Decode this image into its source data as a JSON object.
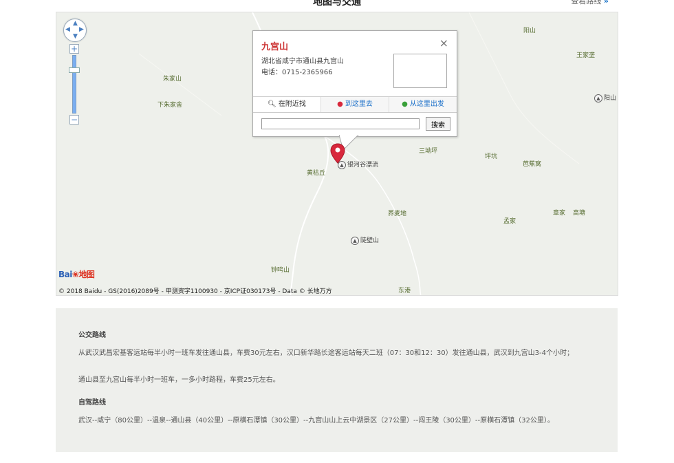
{
  "page": {
    "title": "地图与交通",
    "view_route": "查看路线",
    "view_route_arrow": "»"
  },
  "map": {
    "places": {
      "yangshan": "阳山",
      "wangjiawan": "王家垄",
      "zhujiashan": "朱家山",
      "xiazhujiashe": "下朱家舍",
      "yangshan_peak": "阳山",
      "sandiping": "三坳坪",
      "pingkeng": "坪坑",
      "bajiaowo": "芭蕉窝",
      "huangguqiu": "黄枯丘",
      "yinhegu": "银河谷漂流",
      "qiaomaidi": "荞麦地",
      "mengjia": "孟家",
      "zhangjia": "章家",
      "gaotang": "高塘",
      "doubishan": "陡壁山",
      "zhongmingshan": "钟鸣山",
      "donggang": "东港"
    },
    "zoom_in": "+",
    "zoom_out": "−",
    "logo_text": "Bai",
    "logo_suffix": "地图",
    "copyright": "© 2018 Baidu - GS(2016)2089号 - 甲测资字1100930 - 京ICP证030173号 - Data © 长地万方"
  },
  "popup": {
    "title": "九宫山",
    "close": "×",
    "address": "湖北省咸宁市通山县九宫山",
    "phone": "电话：0715-2365966",
    "tabs": {
      "nearby": "在附近找",
      "to_here": "到这里去",
      "from_here": "从这里出发"
    },
    "search_value": "",
    "search_button": "搜索"
  },
  "routes": {
    "bus_title": "公交路线",
    "bus_line1": "从武汉武昌宏基客运站每半小时一班车发往通山县，车费30元左右，汉口新华路长途客运站每天二班（07：30和12：30）发往通山县，武汉到九宫山3-4个小时；",
    "bus_line2": "通山县至九宫山每半小时一班车，一多小时路程，车费25元左右。",
    "drive_title": "自驾路线",
    "drive_line": "武汉--咸宁（80公里）--温泉--通山县（40公里）--原横石潭镇（30公里）--九宫山山上云中湖景区（27公里）--闯王陵（30公里）--原横石潭镇（32公里）。"
  },
  "colors": {
    "marker": "#d8283c",
    "map_bg": "#eef0eb",
    "link": "#1a6fc9"
  }
}
